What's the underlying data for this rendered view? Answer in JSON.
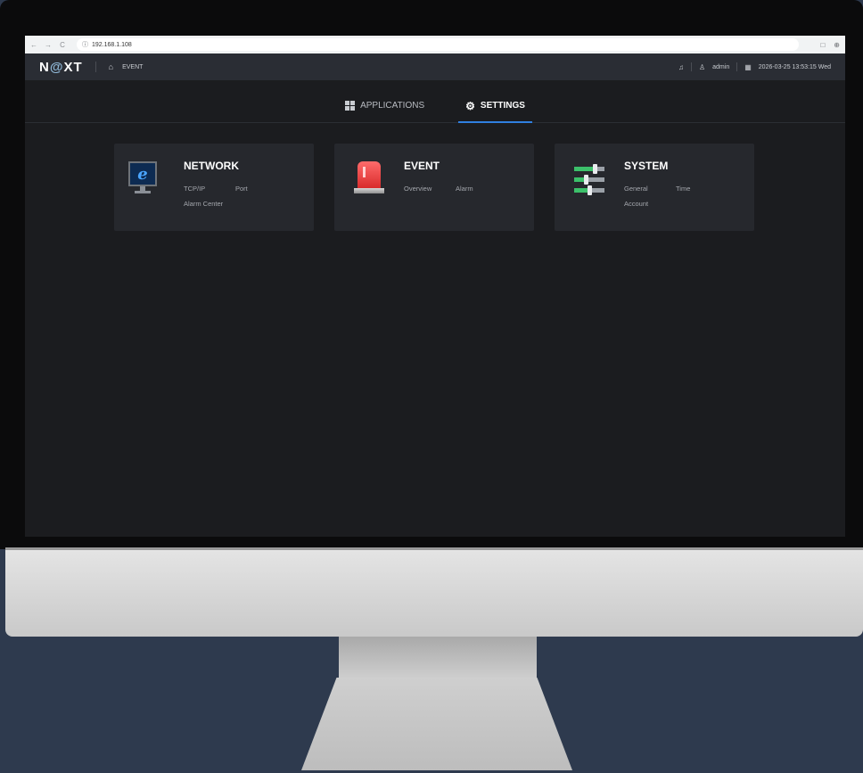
{
  "browser": {
    "url": "192.168.1.108",
    "nav_back": "←",
    "nav_forward": "→",
    "nav_reload": "C",
    "site_info": "ⓘ",
    "right_icons": [
      "□",
      "⊕"
    ]
  },
  "header": {
    "logo_n": "N",
    "logo_o": "@",
    "logo_xt": "XT",
    "breadcrumb": "EVENT",
    "user": "admin",
    "datetime": "2026-03-25 13:53:15 Wed"
  },
  "tabs": [
    {
      "label": "APPLICATIONS",
      "icon": "grid-icon",
      "active": false
    },
    {
      "label": "SETTINGS",
      "icon": "gear-icon",
      "active": true
    }
  ],
  "cards": [
    {
      "title": "NETWORK",
      "icon": "network-monitor-icon",
      "links": [
        "TCP/IP",
        "Port",
        "Alarm Center"
      ]
    },
    {
      "title": "EVENT",
      "icon": "alarm-light-icon",
      "links": [
        "Overview",
        "Alarm"
      ]
    },
    {
      "title": "SYSTEM",
      "icon": "sliders-icon",
      "links": [
        "General",
        "Time",
        "Account"
      ]
    }
  ],
  "colors": {
    "accent": "#2f7fe0",
    "background": "#1b1c1f",
    "card": "#26282d",
    "alarm_red": "#d92b2b",
    "slider_green": "#3cc06a"
  }
}
